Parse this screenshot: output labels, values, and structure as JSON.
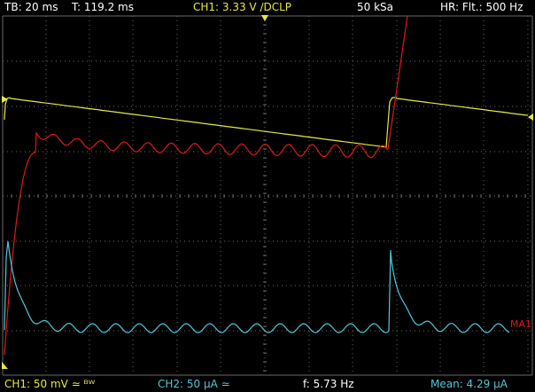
{
  "header": {
    "timebase": "TB: 20 ms",
    "trigger_time": "T: 119.2 ms",
    "channel1": "CH1: 3.33 V ∕DCLP",
    "sample_rate": "50 kSa",
    "acquisition": "HR: Flt.: 500 Hz"
  },
  "footer": {
    "ch1_scale": "CH1: 50 mV ≃ ᴮᵂ",
    "ch2_scale": "CH2: 50 µA ≃",
    "frequency": "f: 5.73 Hz",
    "mean": "Mean: 4.29 µA"
  },
  "math_label": "MA1",
  "colors": {
    "grid": "#6a6a6a",
    "yellow_trace": "#e8e840",
    "red_trace": "#e01818",
    "cyan_trace": "#4fc8d8",
    "header_text": "#ffffff",
    "ch1_header": "#e8e840",
    "footer_ch1": "#e8e840",
    "footer_ch2": "#4fc8d8",
    "math_label": "#e01818",
    "trigger_marker": "#e8e840"
  },
  "icons": {
    "trigger_position": "trigger-position-arrow-icon",
    "ch1_ground": "ch1-ground-marker-icon",
    "ch2_ground": "ch2-ground-marker-icon",
    "trigger_level": "trigger-level-marker-icon"
  }
}
